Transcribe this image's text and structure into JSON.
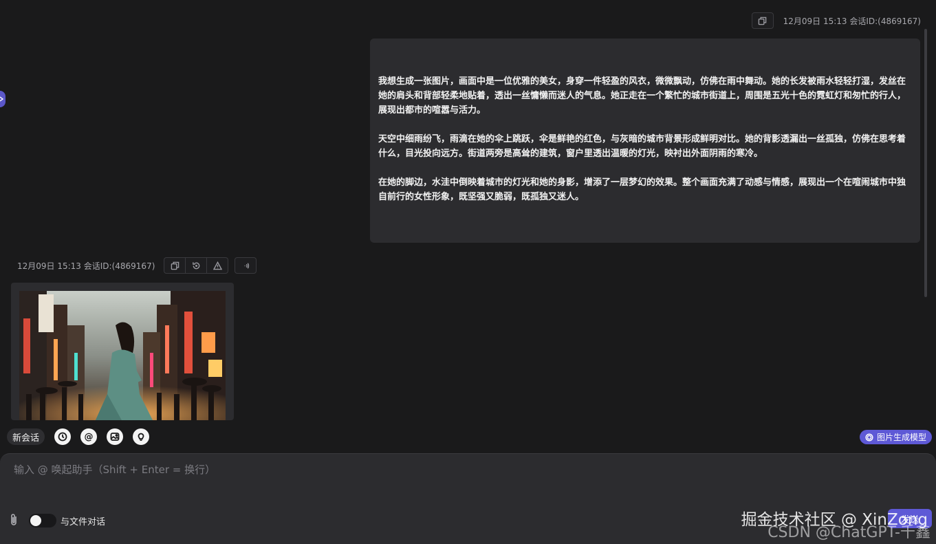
{
  "user_message": {
    "timestamp": "12月09日 15:13 会话ID:(4869167)",
    "paragraphs": [
      "我想生成一张图片，画面中是一位优雅的美女，身穿一件轻盈的风衣，微微飘动，仿佛在雨中舞动。她的长发被雨水轻轻打湿，发丝在她的肩头和背部轻柔地贴着，透出一丝慵懒而迷人的气息。她正走在一个繁忙的城市街道上，周围是五光十色的霓虹灯和匆忙的行人，展现出都市的喧嚣与活力。",
      "天空中细雨纷飞，雨滴在她的伞上跳跃，伞是鲜艳的红色，与灰暗的城市背景形成鲜明对比。她的背影透漏出一丝孤独，仿佛在思考着什么，目光投向远方。街道两旁是高耸的建筑，窗户里透出温暖的灯光，映衬出外面阴雨的寒冷。",
      "在她的脚边，水洼中倒映着城市的灯光和她的身影，增添了一层梦幻的效果。整个画面充满了动感与情感，展现出一个在喧闹城市中独自前行的女性形象，既坚强又脆弱，既孤独又迷人。"
    ]
  },
  "bot_message": {
    "timestamp": "12月09日 15:13 会话ID:(4869167)",
    "icons": [
      "copy-icon",
      "regenerate-icon",
      "warning-icon",
      "speak-icon"
    ]
  },
  "toolbar": {
    "new_chat_label": "新会话",
    "icons": [
      "history-icon",
      "at-icon",
      "image-icon",
      "lightbulb-icon"
    ],
    "at_glyph": "@",
    "model_label": "图片生成模型"
  },
  "composer": {
    "placeholder": "输入 @ 唤起助手（Shift + Enter = 换行）",
    "file_chat_label": "与文件对话",
    "send_label": "发送"
  },
  "watermark": {
    "line1": "掘金技术社区 @ XinZong",
    "line2": "CSDN @ChatGPT-千鑫"
  },
  "colors": {
    "background": "#1a1a1b",
    "bubble": "#2c2c2f",
    "accent": "#5e59d6"
  }
}
